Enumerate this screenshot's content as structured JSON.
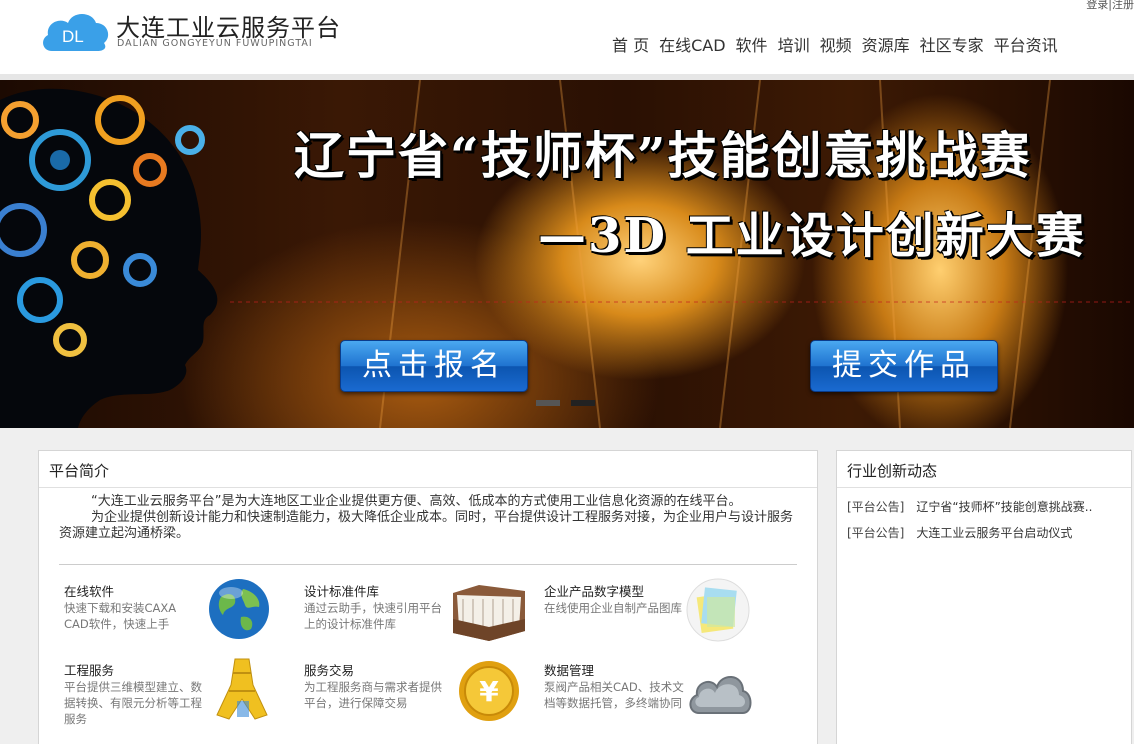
{
  "header": {
    "logo_mark": "DL",
    "title": "大连工业云服务平台",
    "subtitle": "DALIAN GONGYEYUN FUWUPINGTAI",
    "login": "登录|注册",
    "nav": [
      "首 页",
      "在线CAD",
      "软件",
      "培训",
      "视频",
      "资源库",
      "社区专家",
      "平台资讯"
    ],
    "brand_color": "#3aa0e8"
  },
  "banner": {
    "line1": "辽宁省“技师杯”技能创意挑战赛",
    "line2": "—3D 工业设计创新大赛",
    "signup_label": "点击报名",
    "submit_label": "提交作品",
    "button_color": "#1f73d0"
  },
  "intro": {
    "title": "平台简介",
    "para1": "“大连工业云服务平台”是为大连地区工业企业提供更方便、高效、低成本的方式使用工业信息化资源的在线平台。",
    "para2": "为企业提供创新设计能力和快速制造能力，极大降低企业成本。同时，平台提供设计工程服务对接，为企业用户与设计服务资源建立起沟通桥梁。"
  },
  "services": [
    {
      "name": "在线软件",
      "desc": "快速下载和安装CAXA CAD软件，快速上手",
      "icon": "globe-icon"
    },
    {
      "name": "设计标准件库",
      "desc": "通过云助手，快速引用平台上的设计标准件库",
      "icon": "folder-icon"
    },
    {
      "name": "企业产品数字模型",
      "desc": "在线使用企业自制产品图库",
      "icon": "notes-icon"
    },
    {
      "name": "工程服务",
      "desc": "平台提供三维模型建立、数据转换、有限元分析等工程服务",
      "icon": "tower-icon"
    },
    {
      "name": "服务交易",
      "desc": "为工程服务商与需求者提供平台，进行保障交易",
      "icon": "yuan-coin-icon"
    },
    {
      "name": "数据管理",
      "desc": "泵阀产品相关CAD、技术文档等数据托管，多终端协同",
      "icon": "cloud-icon"
    }
  ],
  "news": {
    "title": "行业创新动态",
    "items": [
      {
        "tag": "[平台公告]",
        "text": "辽宁省“技师杯”技能创意挑战赛.."
      },
      {
        "tag": "[平台公告]",
        "text": "大连工业云服务平台启动仪式"
      }
    ]
  }
}
